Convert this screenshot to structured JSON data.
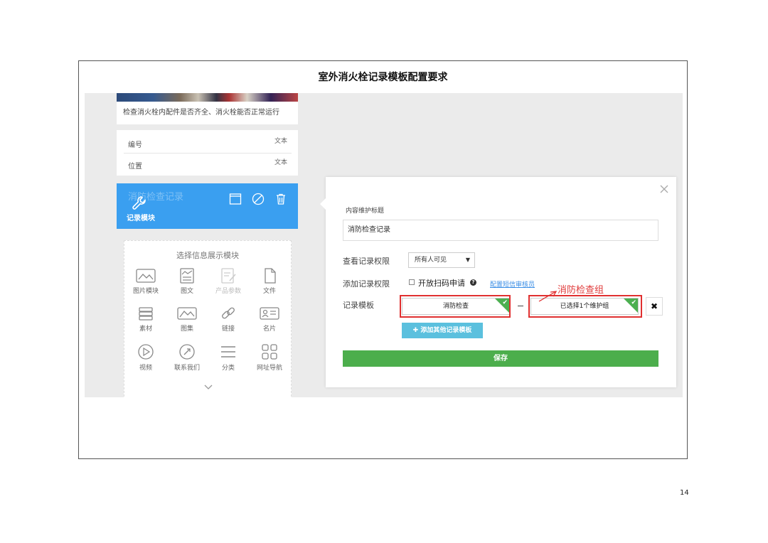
{
  "document": {
    "title": "室外消火栓记录模板配置要求",
    "page_number": "14"
  },
  "left": {
    "caption": "检查消火栓内配件是否齐全、消火栓能否正常运行",
    "fields": [
      {
        "label": "编号",
        "value": "文本"
      },
      {
        "label": "位置",
        "value": "文本"
      }
    ],
    "record_module": {
      "ghost_title": "消防检查记录",
      "label": "记录模块"
    },
    "selector": {
      "title": "选择信息展示模块",
      "modules": [
        "图片模块",
        "图文",
        "产品参数",
        "文件",
        "素材",
        "图集",
        "链接",
        "名片",
        "视频",
        "联系我们",
        "分类",
        "网址导航"
      ]
    }
  },
  "panel": {
    "title_label": "内容维护标题",
    "title_value": "消防检查记录",
    "view_permission_label": "查看记录权限",
    "view_permission_value": "所有人可见",
    "add_permission_label": "添加记录权限",
    "scan_apply_label": "开放扫码申请",
    "config_link": "配置短信审核员",
    "template_label": "记录模板",
    "template_value": "消防检查",
    "group_value": "已选择1个维护组",
    "annotation": "消防检查组",
    "add_template_button": "添加其他记录模板",
    "save_button": "保存"
  },
  "colors": {
    "primary_blue": "#3a9ff0",
    "save_green": "#4cae4c",
    "add_button_blue": "#5bc0de",
    "annotation_red": "#e03030"
  }
}
